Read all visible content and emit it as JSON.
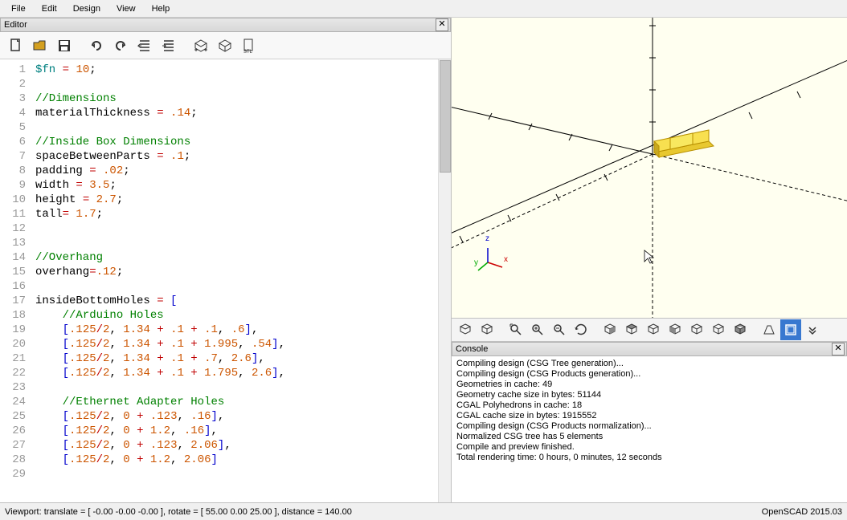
{
  "menubar": [
    "File",
    "Edit",
    "Design",
    "View",
    "Help"
  ],
  "editor_panel_title": "Editor",
  "toolbar_icons": [
    "new",
    "open",
    "save",
    "undo",
    "redo",
    "unindent",
    "indent",
    "render-preview",
    "render",
    "export-stl"
  ],
  "code_lines": [
    {
      "n": 1,
      "tokens": [
        [
          "var",
          "$fn"
        ],
        [
          "text",
          " "
        ],
        [
          "op",
          "="
        ],
        [
          "text",
          " "
        ],
        [
          "num",
          "10"
        ],
        [
          "text",
          ";"
        ]
      ]
    },
    {
      "n": 2,
      "tokens": []
    },
    {
      "n": 3,
      "tokens": [
        [
          "comment",
          "//Dimensions"
        ]
      ]
    },
    {
      "n": 4,
      "tokens": [
        [
          "text",
          "materialThickness "
        ],
        [
          "op",
          "="
        ],
        [
          "text",
          " "
        ],
        [
          "num",
          ".14"
        ],
        [
          "text",
          ";"
        ]
      ]
    },
    {
      "n": 5,
      "tokens": []
    },
    {
      "n": 6,
      "tokens": [
        [
          "comment",
          "//Inside Box Dimensions"
        ]
      ]
    },
    {
      "n": 7,
      "tokens": [
        [
          "text",
          "spaceBetweenParts "
        ],
        [
          "op",
          "="
        ],
        [
          "text",
          " "
        ],
        [
          "num",
          ".1"
        ],
        [
          "text",
          ";"
        ]
      ]
    },
    {
      "n": 8,
      "tokens": [
        [
          "text",
          "padding "
        ],
        [
          "op",
          "="
        ],
        [
          "text",
          " "
        ],
        [
          "num",
          ".02"
        ],
        [
          "text",
          ";"
        ]
      ]
    },
    {
      "n": 9,
      "tokens": [
        [
          "text",
          "width "
        ],
        [
          "op",
          "="
        ],
        [
          "text",
          " "
        ],
        [
          "num",
          "3.5"
        ],
        [
          "text",
          ";"
        ]
      ]
    },
    {
      "n": 10,
      "tokens": [
        [
          "text",
          "height "
        ],
        [
          "op",
          "="
        ],
        [
          "text",
          " "
        ],
        [
          "num",
          "2.7"
        ],
        [
          "text",
          ";"
        ]
      ]
    },
    {
      "n": 11,
      "tokens": [
        [
          "text",
          "tall"
        ],
        [
          "op",
          "="
        ],
        [
          "text",
          " "
        ],
        [
          "num",
          "1.7"
        ],
        [
          "text",
          ";"
        ]
      ]
    },
    {
      "n": 12,
      "tokens": []
    },
    {
      "n": 13,
      "tokens": []
    },
    {
      "n": 14,
      "tokens": [
        [
          "comment",
          "//Overhang"
        ]
      ]
    },
    {
      "n": 15,
      "tokens": [
        [
          "text",
          "overhang"
        ],
        [
          "op",
          "="
        ],
        [
          "num",
          ".12"
        ],
        [
          "text",
          ";"
        ]
      ]
    },
    {
      "n": 16,
      "tokens": []
    },
    {
      "n": 17,
      "tokens": [
        [
          "text",
          "insideBottomHoles "
        ],
        [
          "op",
          "="
        ],
        [
          "text",
          " "
        ],
        [
          "bracket",
          "["
        ]
      ]
    },
    {
      "n": 18,
      "tokens": [
        [
          "text",
          "    "
        ],
        [
          "comment",
          "//Arduino Holes"
        ]
      ]
    },
    {
      "n": 19,
      "tokens": [
        [
          "text",
          "    "
        ],
        [
          "bracket",
          "["
        ],
        [
          "num",
          ".125"
        ],
        [
          "op",
          "/"
        ],
        [
          "num",
          "2"
        ],
        [
          "text",
          ", "
        ],
        [
          "num",
          "1.34"
        ],
        [
          "text",
          " "
        ],
        [
          "op",
          "+"
        ],
        [
          "text",
          " "
        ],
        [
          "num",
          ".1"
        ],
        [
          "text",
          " "
        ],
        [
          "op",
          "+"
        ],
        [
          "text",
          " "
        ],
        [
          "num",
          ".1"
        ],
        [
          "text",
          ", "
        ],
        [
          "num",
          ".6"
        ],
        [
          "bracket",
          "]"
        ],
        [
          "text",
          ","
        ]
      ]
    },
    {
      "n": 20,
      "tokens": [
        [
          "text",
          "    "
        ],
        [
          "bracket",
          "["
        ],
        [
          "num",
          ".125"
        ],
        [
          "op",
          "/"
        ],
        [
          "num",
          "2"
        ],
        [
          "text",
          ", "
        ],
        [
          "num",
          "1.34"
        ],
        [
          "text",
          " "
        ],
        [
          "op",
          "+"
        ],
        [
          "text",
          " "
        ],
        [
          "num",
          ".1"
        ],
        [
          "text",
          " "
        ],
        [
          "op",
          "+"
        ],
        [
          "text",
          " "
        ],
        [
          "num",
          "1.995"
        ],
        [
          "text",
          ", "
        ],
        [
          "num",
          ".54"
        ],
        [
          "bracket",
          "]"
        ],
        [
          "text",
          ","
        ]
      ]
    },
    {
      "n": 21,
      "tokens": [
        [
          "text",
          "    "
        ],
        [
          "bracket",
          "["
        ],
        [
          "num",
          ".125"
        ],
        [
          "op",
          "/"
        ],
        [
          "num",
          "2"
        ],
        [
          "text",
          ", "
        ],
        [
          "num",
          "1.34"
        ],
        [
          "text",
          " "
        ],
        [
          "op",
          "+"
        ],
        [
          "text",
          " "
        ],
        [
          "num",
          ".1"
        ],
        [
          "text",
          " "
        ],
        [
          "op",
          "+"
        ],
        [
          "text",
          " "
        ],
        [
          "num",
          ".7"
        ],
        [
          "text",
          ", "
        ],
        [
          "num",
          "2.6"
        ],
        [
          "bracket",
          "]"
        ],
        [
          "text",
          ","
        ]
      ]
    },
    {
      "n": 22,
      "tokens": [
        [
          "text",
          "    "
        ],
        [
          "bracket",
          "["
        ],
        [
          "num",
          ".125"
        ],
        [
          "op",
          "/"
        ],
        [
          "num",
          "2"
        ],
        [
          "text",
          ", "
        ],
        [
          "num",
          "1.34"
        ],
        [
          "text",
          " "
        ],
        [
          "op",
          "+"
        ],
        [
          "text",
          " "
        ],
        [
          "num",
          ".1"
        ],
        [
          "text",
          " "
        ],
        [
          "op",
          "+"
        ],
        [
          "text",
          " "
        ],
        [
          "num",
          "1.795"
        ],
        [
          "text",
          ", "
        ],
        [
          "num",
          "2.6"
        ],
        [
          "bracket",
          "]"
        ],
        [
          "text",
          ","
        ]
      ]
    },
    {
      "n": 23,
      "tokens": []
    },
    {
      "n": 24,
      "tokens": [
        [
          "text",
          "    "
        ],
        [
          "comment",
          "//Ethernet Adapter Holes"
        ]
      ]
    },
    {
      "n": 25,
      "tokens": [
        [
          "text",
          "    "
        ],
        [
          "bracket",
          "["
        ],
        [
          "num",
          ".125"
        ],
        [
          "op",
          "/"
        ],
        [
          "num",
          "2"
        ],
        [
          "text",
          ", "
        ],
        [
          "num",
          "0"
        ],
        [
          "text",
          " "
        ],
        [
          "op",
          "+"
        ],
        [
          "text",
          " "
        ],
        [
          "num",
          ".123"
        ],
        [
          "text",
          ", "
        ],
        [
          "num",
          ".16"
        ],
        [
          "bracket",
          "]"
        ],
        [
          "text",
          ","
        ]
      ]
    },
    {
      "n": 26,
      "tokens": [
        [
          "text",
          "    "
        ],
        [
          "bracket",
          "["
        ],
        [
          "num",
          ".125"
        ],
        [
          "op",
          "/"
        ],
        [
          "num",
          "2"
        ],
        [
          "text",
          ", "
        ],
        [
          "num",
          "0"
        ],
        [
          "text",
          " "
        ],
        [
          "op",
          "+"
        ],
        [
          "text",
          " "
        ],
        [
          "num",
          "1.2"
        ],
        [
          "text",
          ", "
        ],
        [
          "num",
          ".16"
        ],
        [
          "bracket",
          "]"
        ],
        [
          "text",
          ","
        ]
      ]
    },
    {
      "n": 27,
      "tokens": [
        [
          "text",
          "    "
        ],
        [
          "bracket",
          "["
        ],
        [
          "num",
          ".125"
        ],
        [
          "op",
          "/"
        ],
        [
          "num",
          "2"
        ],
        [
          "text",
          ", "
        ],
        [
          "num",
          "0"
        ],
        [
          "text",
          " "
        ],
        [
          "op",
          "+"
        ],
        [
          "text",
          " "
        ],
        [
          "num",
          ".123"
        ],
        [
          "text",
          ", "
        ],
        [
          "num",
          "2.06"
        ],
        [
          "bracket",
          "]"
        ],
        [
          "text",
          ","
        ]
      ]
    },
    {
      "n": 28,
      "tokens": [
        [
          "text",
          "    "
        ],
        [
          "bracket",
          "["
        ],
        [
          "num",
          ".125"
        ],
        [
          "op",
          "/"
        ],
        [
          "num",
          "2"
        ],
        [
          "text",
          ", "
        ],
        [
          "num",
          "0"
        ],
        [
          "text",
          " "
        ],
        [
          "op",
          "+"
        ],
        [
          "text",
          " "
        ],
        [
          "num",
          "1.2"
        ],
        [
          "text",
          ", "
        ],
        [
          "num",
          "2.06"
        ],
        [
          "bracket",
          "]"
        ]
      ]
    },
    {
      "n": 29,
      "tokens": []
    }
  ],
  "viewport_toolbar": [
    "preview",
    "render",
    "zoom-fit",
    "zoom-in",
    "zoom-out",
    "reset-view",
    "view-right",
    "view-top",
    "view-bottom",
    "view-left",
    "view-front",
    "view-back",
    "view-diagonal",
    "perspective",
    "show-axes",
    "more"
  ],
  "console_title": "Console",
  "console_lines": [
    "Compiling design (CSG Tree generation)...",
    "Compiling design (CSG Products generation)...",
    "Geometries in cache: 49",
    "Geometry cache size in bytes: 51144",
    "CGAL Polyhedrons in cache: 18",
    "CGAL cache size in bytes: 1915552",
    "Compiling design (CSG Products normalization)...",
    "Normalized CSG tree has 5 elements",
    "Compile and preview finished.",
    "Total rendering time: 0 hours, 0 minutes, 12 seconds"
  ],
  "status_left": "Viewport: translate = [ -0.00 -0.00 -0.00 ], rotate = [ 55.00 0.00 25.00 ], distance = 140.00",
  "status_right": "OpenSCAD 2015.03",
  "axis_labels": {
    "x": "x",
    "y": "y",
    "z": "z"
  }
}
